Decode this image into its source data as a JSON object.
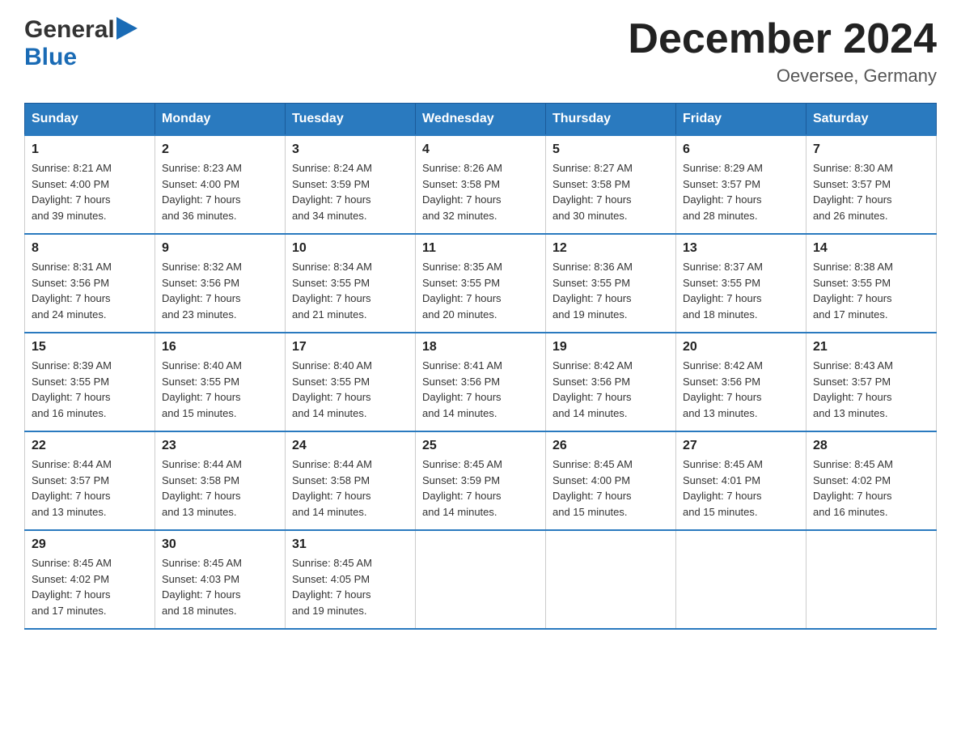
{
  "header": {
    "logo_general": "General",
    "logo_blue": "Blue",
    "month_title": "December 2024",
    "location": "Oeversee, Germany"
  },
  "days_of_week": [
    "Sunday",
    "Monday",
    "Tuesday",
    "Wednesday",
    "Thursday",
    "Friday",
    "Saturday"
  ],
  "weeks": [
    [
      {
        "day": "1",
        "sunrise": "8:21 AM",
        "sunset": "4:00 PM",
        "daylight": "7 hours and 39 minutes."
      },
      {
        "day": "2",
        "sunrise": "8:23 AM",
        "sunset": "4:00 PM",
        "daylight": "7 hours and 36 minutes."
      },
      {
        "day": "3",
        "sunrise": "8:24 AM",
        "sunset": "3:59 PM",
        "daylight": "7 hours and 34 minutes."
      },
      {
        "day": "4",
        "sunrise": "8:26 AM",
        "sunset": "3:58 PM",
        "daylight": "7 hours and 32 minutes."
      },
      {
        "day": "5",
        "sunrise": "8:27 AM",
        "sunset": "3:58 PM",
        "daylight": "7 hours and 30 minutes."
      },
      {
        "day": "6",
        "sunrise": "8:29 AM",
        "sunset": "3:57 PM",
        "daylight": "7 hours and 28 minutes."
      },
      {
        "day": "7",
        "sunrise": "8:30 AM",
        "sunset": "3:57 PM",
        "daylight": "7 hours and 26 minutes."
      }
    ],
    [
      {
        "day": "8",
        "sunrise": "8:31 AM",
        "sunset": "3:56 PM",
        "daylight": "7 hours and 24 minutes."
      },
      {
        "day": "9",
        "sunrise": "8:32 AM",
        "sunset": "3:56 PM",
        "daylight": "7 hours and 23 minutes."
      },
      {
        "day": "10",
        "sunrise": "8:34 AM",
        "sunset": "3:55 PM",
        "daylight": "7 hours and 21 minutes."
      },
      {
        "day": "11",
        "sunrise": "8:35 AM",
        "sunset": "3:55 PM",
        "daylight": "7 hours and 20 minutes."
      },
      {
        "day": "12",
        "sunrise": "8:36 AM",
        "sunset": "3:55 PM",
        "daylight": "7 hours and 19 minutes."
      },
      {
        "day": "13",
        "sunrise": "8:37 AM",
        "sunset": "3:55 PM",
        "daylight": "7 hours and 18 minutes."
      },
      {
        "day": "14",
        "sunrise": "8:38 AM",
        "sunset": "3:55 PM",
        "daylight": "7 hours and 17 minutes."
      }
    ],
    [
      {
        "day": "15",
        "sunrise": "8:39 AM",
        "sunset": "3:55 PM",
        "daylight": "7 hours and 16 minutes."
      },
      {
        "day": "16",
        "sunrise": "8:40 AM",
        "sunset": "3:55 PM",
        "daylight": "7 hours and 15 minutes."
      },
      {
        "day": "17",
        "sunrise": "8:40 AM",
        "sunset": "3:55 PM",
        "daylight": "7 hours and 14 minutes."
      },
      {
        "day": "18",
        "sunrise": "8:41 AM",
        "sunset": "3:56 PM",
        "daylight": "7 hours and 14 minutes."
      },
      {
        "day": "19",
        "sunrise": "8:42 AM",
        "sunset": "3:56 PM",
        "daylight": "7 hours and 14 minutes."
      },
      {
        "day": "20",
        "sunrise": "8:42 AM",
        "sunset": "3:56 PM",
        "daylight": "7 hours and 13 minutes."
      },
      {
        "day": "21",
        "sunrise": "8:43 AM",
        "sunset": "3:57 PM",
        "daylight": "7 hours and 13 minutes."
      }
    ],
    [
      {
        "day": "22",
        "sunrise": "8:44 AM",
        "sunset": "3:57 PM",
        "daylight": "7 hours and 13 minutes."
      },
      {
        "day": "23",
        "sunrise": "8:44 AM",
        "sunset": "3:58 PM",
        "daylight": "7 hours and 13 minutes."
      },
      {
        "day": "24",
        "sunrise": "8:44 AM",
        "sunset": "3:58 PM",
        "daylight": "7 hours and 14 minutes."
      },
      {
        "day": "25",
        "sunrise": "8:45 AM",
        "sunset": "3:59 PM",
        "daylight": "7 hours and 14 minutes."
      },
      {
        "day": "26",
        "sunrise": "8:45 AM",
        "sunset": "4:00 PM",
        "daylight": "7 hours and 15 minutes."
      },
      {
        "day": "27",
        "sunrise": "8:45 AM",
        "sunset": "4:01 PM",
        "daylight": "7 hours and 15 minutes."
      },
      {
        "day": "28",
        "sunrise": "8:45 AM",
        "sunset": "4:02 PM",
        "daylight": "7 hours and 16 minutes."
      }
    ],
    [
      {
        "day": "29",
        "sunrise": "8:45 AM",
        "sunset": "4:02 PM",
        "daylight": "7 hours and 17 minutes."
      },
      {
        "day": "30",
        "sunrise": "8:45 AM",
        "sunset": "4:03 PM",
        "daylight": "7 hours and 18 minutes."
      },
      {
        "day": "31",
        "sunrise": "8:45 AM",
        "sunset": "4:05 PM",
        "daylight": "7 hours and 19 minutes."
      },
      null,
      null,
      null,
      null
    ]
  ],
  "labels": {
    "sunrise": "Sunrise:",
    "sunset": "Sunset:",
    "daylight": "Daylight:"
  }
}
